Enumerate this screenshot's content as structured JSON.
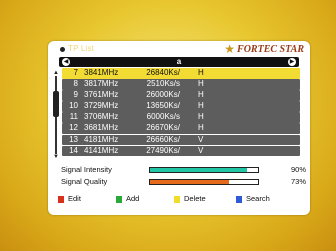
{
  "header": {
    "title": "TP List",
    "brand": "FORTEC STAR"
  },
  "satellite": {
    "name": "a",
    "left_arrow": "◀",
    "right_arrow": "▶"
  },
  "rows": [
    {
      "num": "7",
      "freq": "3841MHz",
      "sr": "26840Ks/",
      "pol": "H"
    },
    {
      "num": "8",
      "freq": "3817MHz",
      "sr": "2510Ks/s",
      "pol": "H"
    },
    {
      "num": "9",
      "freq": "3761MHz",
      "sr": "26000Ks/",
      "pol": "H"
    },
    {
      "num": "10",
      "freq": "3729MHz",
      "sr": "13650Ks/",
      "pol": "H"
    },
    {
      "num": "11",
      "freq": "3706MHz",
      "sr": "6000Ks/s",
      "pol": "H"
    },
    {
      "num": "12",
      "freq": "3681MHz",
      "sr": "26670Ks/",
      "pol": "H"
    },
    {
      "num": "13",
      "freq": "4181MHz",
      "sr": "26660Ks/",
      "pol": "V"
    },
    {
      "num": "14",
      "freq": "4141MHz",
      "sr": "27490Ks/",
      "pol": "V"
    }
  ],
  "signal": {
    "intensity_label": "Signal Intensity",
    "intensity_value": 90,
    "intensity_text": "90%",
    "intensity_color": "#21c6a4",
    "quality_label": "Signal Quality",
    "quality_value": 73,
    "quality_text": "73%",
    "quality_color": "#e66a1c"
  },
  "footer": {
    "edit_label": "Edit",
    "edit_color": "#d8301c",
    "add_label": "Add",
    "add_color": "#2aa83a",
    "delete_label": "Delete",
    "delete_color": "#f1dc2c",
    "search_label": "Search",
    "search_color": "#2e5bd6"
  }
}
